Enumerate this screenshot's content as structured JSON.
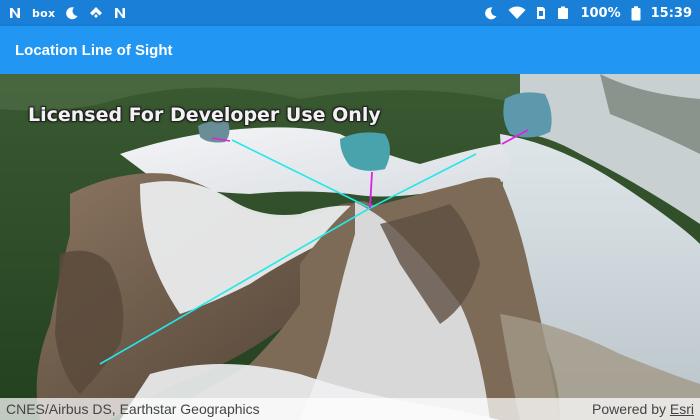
{
  "status_bar": {
    "left_icons": [
      "n-notification-icon",
      "box-app-icon",
      "moon-icon",
      "feedly-icon",
      "n-notification-icon"
    ],
    "box_label": "box",
    "right_icons": [
      "do-not-disturb-icon",
      "wifi-icon",
      "sim-no-signal-icon",
      "battery-icon"
    ],
    "battery_percent": "100%",
    "time": "15:39"
  },
  "app_bar": {
    "title": "Location Line of Sight"
  },
  "map": {
    "license_watermark": "Licensed For Developer Use Only",
    "line_of_sight_colors": {
      "visible": "#22e8e8",
      "observer": "#e020e0"
    }
  },
  "attribution": {
    "sources": "CNES/Airbus DS, Earthstar Geographics",
    "powered_by_prefix": "Powered by ",
    "powered_by_link": "Esri"
  },
  "colors": {
    "status_bar": "#1a7fd6",
    "app_bar": "#2196f3"
  }
}
